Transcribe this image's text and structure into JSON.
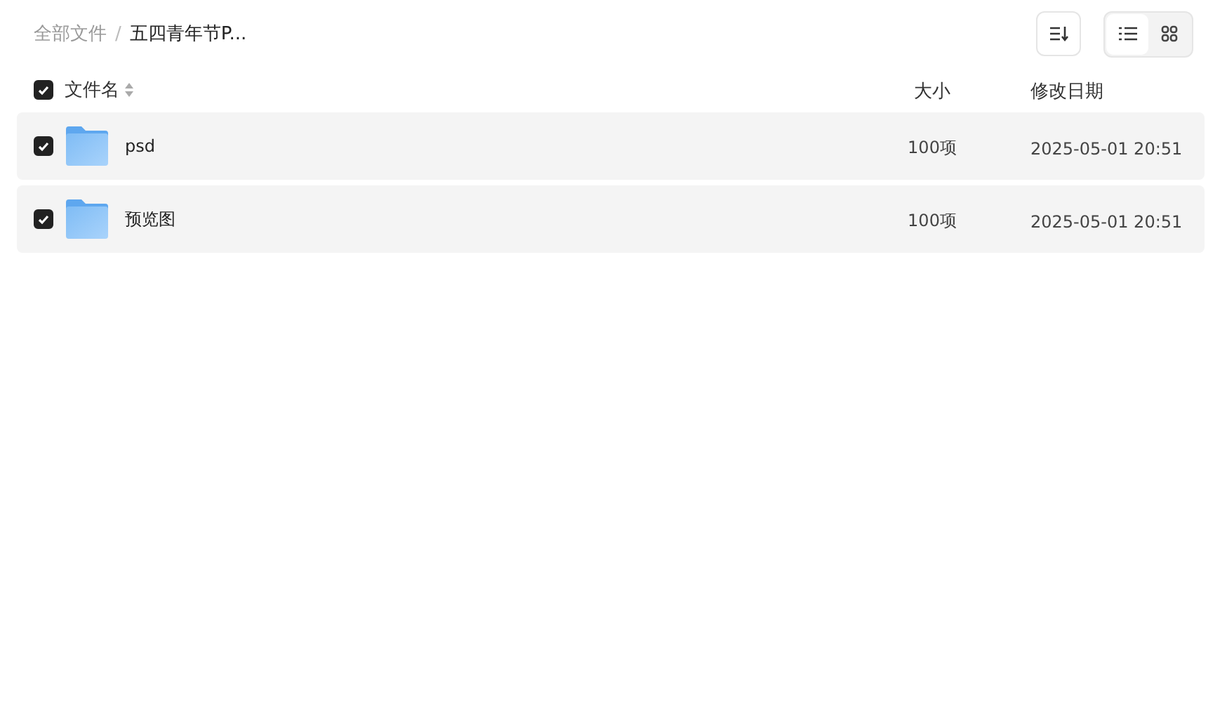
{
  "breadcrumb_separator": "/",
  "breadcrumb": [
    {
      "label": "全部文件",
      "current": false
    },
    {
      "label": "五四青年节P...",
      "current": true
    }
  ],
  "view_modes": [
    {
      "kind": "list",
      "selected": true
    },
    {
      "kind": "grid",
      "selected": false
    }
  ],
  "table": {
    "select_all": {
      "checked": true
    },
    "columns": [
      "文件名",
      "大小",
      "修改日期"
    ],
    "rows": [
      {
        "name": "psd",
        "size": "100项",
        "modified": "2025-05-01 20:51",
        "checked": true
      },
      {
        "name": "预览图",
        "size": "100项",
        "modified": "2025-05-01 20:51",
        "checked": true
      }
    ]
  }
}
